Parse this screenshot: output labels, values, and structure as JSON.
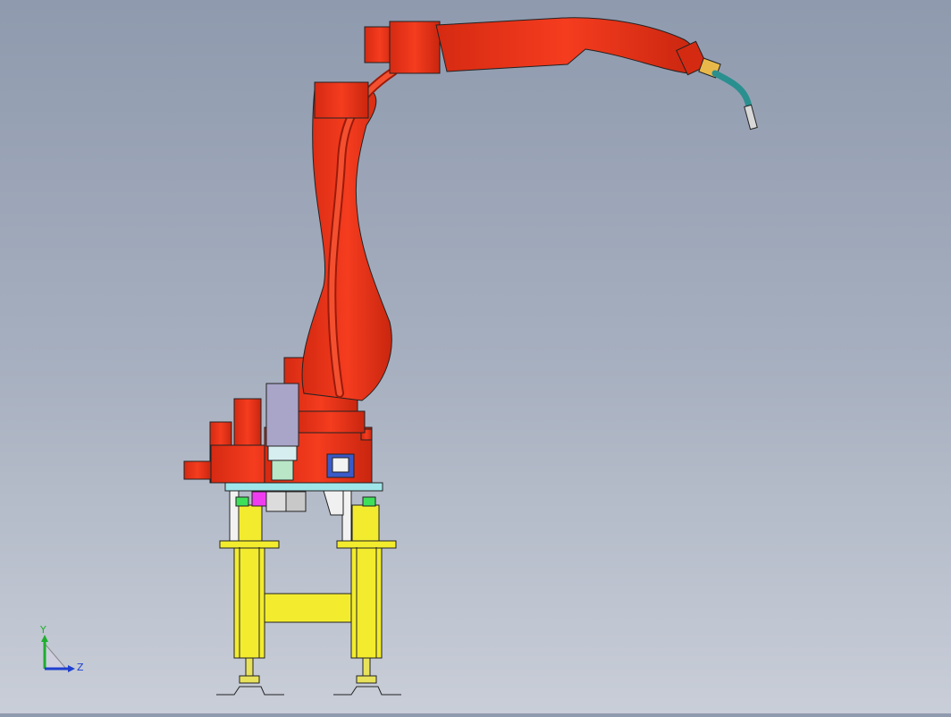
{
  "viewport": {
    "background_top": "#8f9aae",
    "background_bottom": "#c9ced8"
  },
  "model": {
    "parts": [
      {
        "name": "robot-arm",
        "color": "#f23a1e"
      },
      {
        "name": "servo-motor",
        "color": "#a9a5c9"
      },
      {
        "name": "mounting-plate",
        "color": "#9fe6ea"
      },
      {
        "name": "stand-frame",
        "color": "#f3ec2e"
      },
      {
        "name": "welding-torch-cable",
        "color": "#2a8f8f"
      },
      {
        "name": "torch-tip",
        "color": "#d8d8d8"
      }
    ]
  },
  "triad": {
    "y_label": "Y",
    "z_label": "Z",
    "y_color": "#1fae2e",
    "z_color": "#1f3fcf"
  }
}
